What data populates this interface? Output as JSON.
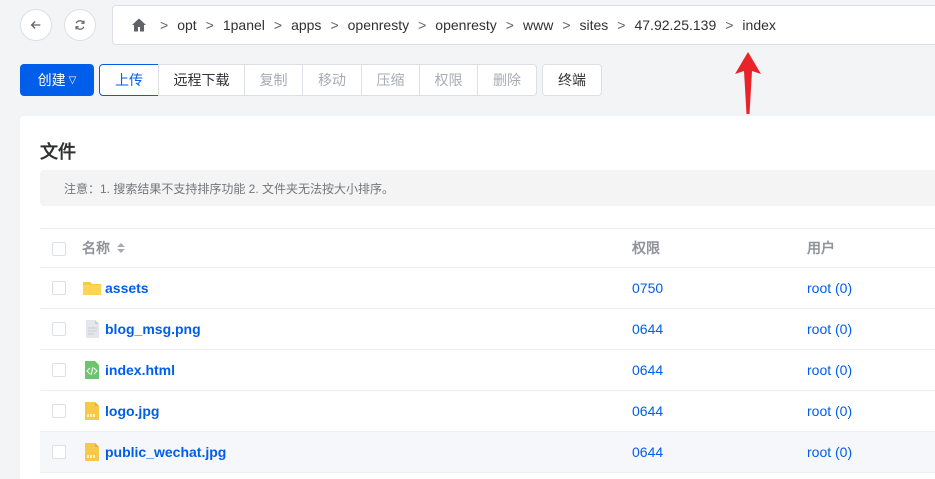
{
  "breadcrumb": {
    "items": [
      "opt",
      "1panel",
      "apps",
      "openresty",
      "openresty",
      "www",
      "sites",
      "47.92.25.139",
      "index"
    ],
    "separator": ">"
  },
  "toolbar": {
    "create": "创建",
    "upload": "上传",
    "remote_download": "远程下载",
    "copy": "复制",
    "move": "移动",
    "compress": "压缩",
    "permission": "权限",
    "delete": "删除",
    "terminal": "终端"
  },
  "card": {
    "title": "文件",
    "notice": "注意：1. 搜索结果不支持排序功能 2. 文件夹无法按大小排序。"
  },
  "table": {
    "headers": {
      "name": "名称",
      "permission": "权限",
      "user": "用户"
    },
    "rows": [
      {
        "name": "assets",
        "icon": "folder-icon",
        "perm": "0750",
        "user": "root (0)"
      },
      {
        "name": "blog_msg.png",
        "icon": "image-file-icon",
        "perm": "0644",
        "user": "root (0)"
      },
      {
        "name": "index.html",
        "icon": "html-file-icon",
        "perm": "0644",
        "user": "root (0)"
      },
      {
        "name": "logo.jpg",
        "icon": "jpg-file-icon",
        "perm": "0644",
        "user": "root (0)"
      },
      {
        "name": "public_wechat.jpg",
        "icon": "jpg-file-icon",
        "perm": "0644",
        "user": "root (0)"
      }
    ]
  },
  "colors": {
    "primary": "#005eeb",
    "annotation_arrow": "#e8232a"
  }
}
